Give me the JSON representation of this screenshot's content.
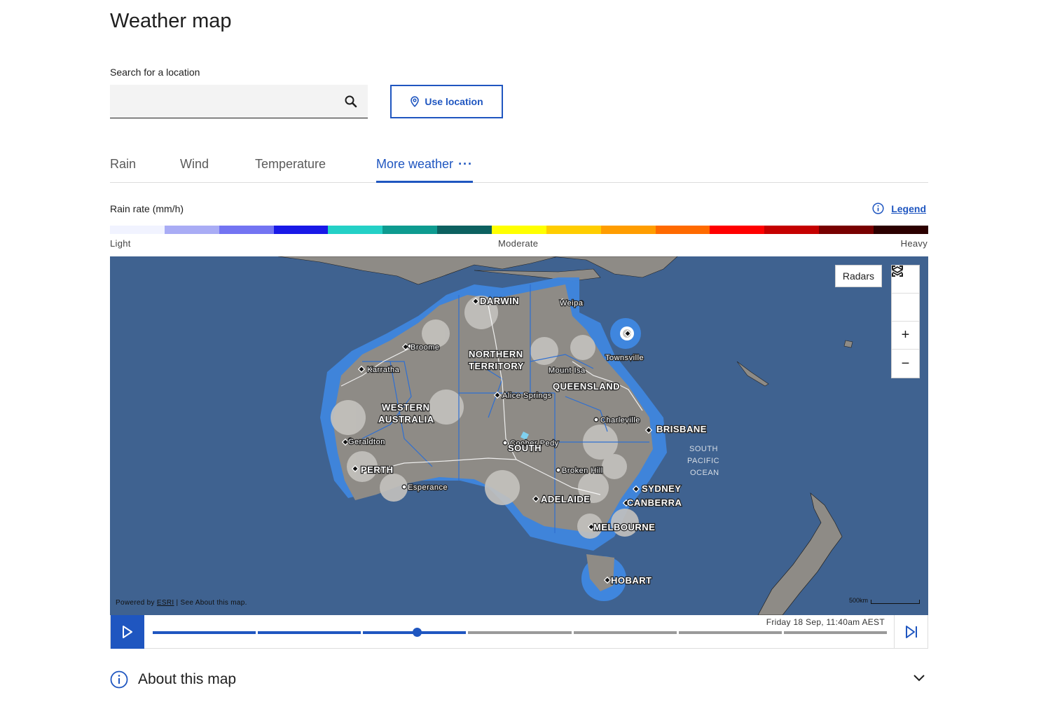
{
  "page": {
    "title": "Weather map"
  },
  "search": {
    "label": "Search for a location",
    "value": "",
    "placeholder": ""
  },
  "location": {
    "button_label": "Use location"
  },
  "tabs": [
    {
      "label": "Rain",
      "active": false
    },
    {
      "label": "Wind",
      "active": false
    },
    {
      "label": "Temperature",
      "active": false
    },
    {
      "label": "More weather",
      "active": true
    }
  ],
  "legend": {
    "title": "Rain rate (mm/h)",
    "link_label": "Legend",
    "scale_labels": {
      "light": "Light",
      "moderate": "Moderate",
      "heavy": "Heavy"
    },
    "colors": [
      "#f1f3ff",
      "#a9acf5",
      "#7374f2",
      "#1919e7",
      "#24d0c6",
      "#0e9b90",
      "#0d6160",
      "#ffff00",
      "#ffcd00",
      "#ff9d00",
      "#ff6a00",
      "#ff0000",
      "#c50000",
      "#780000",
      "#2c0000"
    ]
  },
  "map": {
    "radars_label": "Radars",
    "controls": [
      "fullscreen-icon",
      "layers-icon",
      "zoom-in-icon",
      "zoom-out-icon"
    ],
    "attribution": {
      "prefix": "Powered by",
      "link": "ESRI",
      "suffix": "| See About this map."
    },
    "scale_label": "500km",
    "places": {
      "darwin": "DARWIN",
      "weipa": "Weipa",
      "broome": "Broome",
      "northern_territory": [
        "NORTHERN",
        "TERRITORY"
      ],
      "townsville": "Townsville",
      "karratha": "Karratha",
      "mount_isa": "Mount Isa",
      "queensland": "QUEENSLAND",
      "alice_springs": "Alice Springs",
      "western_australia": [
        "WESTERN",
        "AUSTRALIA"
      ],
      "charleville": "Charleville",
      "brisbane": "BRISBANE",
      "geraldton": "Geraldton",
      "coober_pedy": "Coober Pedy",
      "south": "SOUTH",
      "perth": "PERTH",
      "broken_hill": "Broken Hill",
      "esperance": "Esperance",
      "sydney": "SYDNEY",
      "adelaide": "ADELAIDE",
      "canberra": "CANBERRA",
      "melbourne": "MELBOURNE",
      "hobart": "HOBART",
      "south_pacific_ocean": [
        "SOUTH",
        "PACIFIC",
        "OCEAN"
      ]
    }
  },
  "timeline": {
    "timestamp": "Friday 18 Sep, 11:40am AEST",
    "segments": 7,
    "completed_segments": 3,
    "position": 0.36
  },
  "about": {
    "title": "About this map"
  }
}
